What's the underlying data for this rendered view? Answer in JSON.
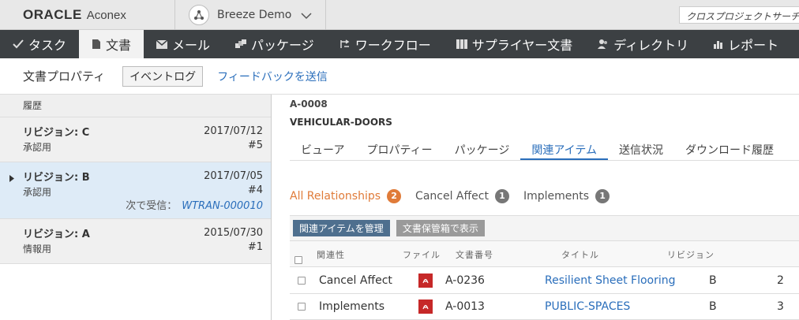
{
  "header": {
    "logo_brand": "ORACLE",
    "logo_product": "Aconex",
    "project_name": "Breeze Demo",
    "search_placeholder": "クロスプロジェクトサーチ"
  },
  "nav": [
    {
      "label": "タスク",
      "icon": "check-icon"
    },
    {
      "label": "文書",
      "icon": "document-icon"
    },
    {
      "label": "メール",
      "icon": "mail-icon"
    },
    {
      "label": "パッケージ",
      "icon": "package-icon"
    },
    {
      "label": "ワークフロー",
      "icon": "workflow-icon"
    },
    {
      "label": "サプライヤー文書",
      "icon": "supplier-icon"
    },
    {
      "label": "ディレクトリ",
      "icon": "users-icon"
    },
    {
      "label": "レポート",
      "icon": "chart-icon"
    }
  ],
  "subbar": {
    "title": "文書プロパティ",
    "event_log": "イベントログ",
    "feedback": "フィードバックを送信"
  },
  "history": {
    "heading": "履歴",
    "revisions": [
      {
        "label": "リビジョン: C",
        "date": "2017/07/12",
        "status": "承認用",
        "num": "#5"
      },
      {
        "label": "リビジョン: B",
        "date": "2017/07/05",
        "status": "承認用",
        "num": "#4",
        "next_label": "次で受信：",
        "next_link": "WTRAN-000010"
      },
      {
        "label": "リビジョン: A",
        "date": "2015/07/30",
        "status": "情報用",
        "num": "#1"
      }
    ]
  },
  "doc": {
    "number": "A-0008",
    "title": "VEHICULAR-DOORS",
    "tabs": [
      "ビューア",
      "プロパティー",
      "パッケージ",
      "関連アイテム",
      "送信状況",
      "ダウンロード履歴"
    ]
  },
  "relationships": {
    "filters": [
      {
        "label": "All Relationships",
        "count": "2"
      },
      {
        "label": "Cancel Affect",
        "count": "1"
      },
      {
        "label": "Implements",
        "count": "1"
      }
    ],
    "manage_button": "関連アイテムを管理",
    "view_button": "文書保管箱で表示",
    "columns": {
      "relation": "関連性",
      "file": "ファイル",
      "docnum": "文書番号",
      "title": "タイトル",
      "revision": "リビジョン"
    },
    "rows": [
      {
        "relation": "Cancel Affect",
        "docnum": "A-0236",
        "title": "Resilient Sheet Flooring",
        "revision": "B",
        "extra": "2"
      },
      {
        "relation": "Implements",
        "docnum": "A-0013",
        "title": "PUBLIC-SPACES",
        "revision": "B",
        "extra": "3"
      }
    ]
  },
  "colors": {
    "nav_bg": "#3c4043",
    "link": "#2a6ebb",
    "accent": "#e07b39",
    "pdf": "#c62828"
  }
}
